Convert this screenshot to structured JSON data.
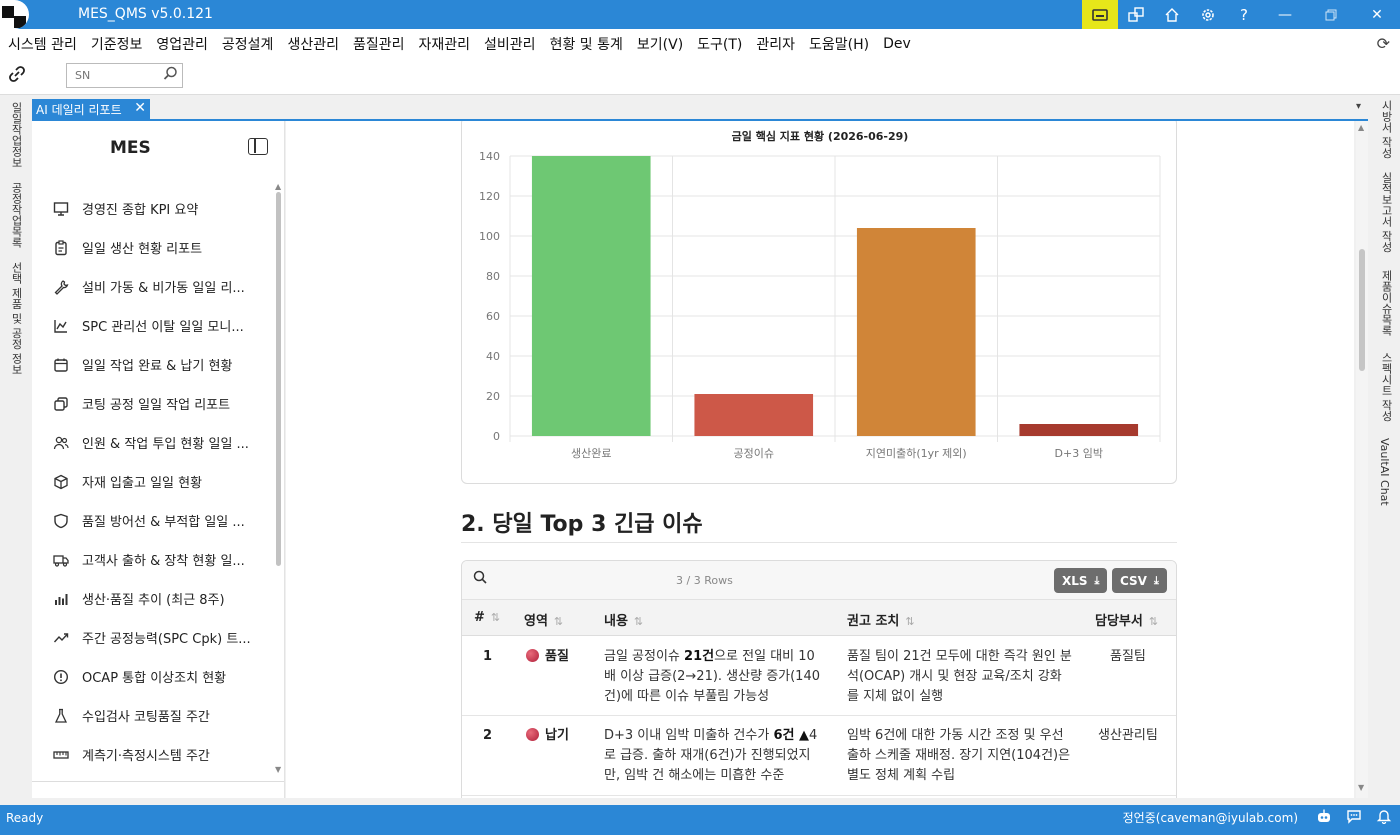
{
  "app": {
    "title": "MES_QMS v5.0.121"
  },
  "menu": [
    "시스템 관리",
    "기준정보",
    "영업관리",
    "공정설계",
    "생산관리",
    "품질관리",
    "자재관리",
    "설비관리",
    "현황 및 통계",
    "보기(V)",
    "도구(T)",
    "관리자",
    "도움말(H)",
    "Dev"
  ],
  "toolbar": {
    "sn_placeholder": "SN"
  },
  "left_tabs": [
    "일일작업정보",
    "공정작업목록",
    "선택 제품 및 공정 정보"
  ],
  "right_tabs": [
    "시방서 작성",
    "실적보고서 작성",
    "제품이슈목록",
    "스펙시트 작성",
    "VaultAI Chat"
  ],
  "doc_tab": {
    "label": "AI 데일리 리포트",
    "close": "✕"
  },
  "sidebar": {
    "title": "MES",
    "items": [
      {
        "label": "경영진 종합 KPI 요약",
        "icon": "presentation-icon"
      },
      {
        "label": "일일 생산 현황 리포트",
        "icon": "clipboard-icon"
      },
      {
        "label": "설비 가동 & 비가동 일일 리...",
        "icon": "wrench-icon"
      },
      {
        "label": "SPC 관리선 이탈 일일 모니...",
        "icon": "spc-chart-icon"
      },
      {
        "label": "일일 작업 완료 & 납기 현황",
        "icon": "calendar-icon"
      },
      {
        "label": "코팅 공정 일일 작업 리포트",
        "icon": "layers-icon"
      },
      {
        "label": "인원 & 작업 투입 현황 일일 ...",
        "icon": "users-icon"
      },
      {
        "label": "자재 입출고 일일 현황",
        "icon": "box-icon"
      },
      {
        "label": "품질 방어선 & 부적합 일일 ...",
        "icon": "shield-icon"
      },
      {
        "label": "고객사 출하 & 장착 현황 일...",
        "icon": "truck-icon"
      },
      {
        "label": "생산·품질 추이 (최근 8주)",
        "icon": "bar-chart-icon"
      },
      {
        "label": "주간 공정능력(SPC Cpk) 트...",
        "icon": "trend-icon"
      },
      {
        "label": "OCAP 통합 이상조치 현황",
        "icon": "alert-icon"
      },
      {
        "label": "수입검사 코팅품질 주간",
        "icon": "flask-icon"
      },
      {
        "label": "계측기·측정시스템 주간",
        "icon": "ruler-icon"
      }
    ]
  },
  "chart_data": {
    "type": "bar",
    "title": "금일 핵심 지표 현황 (2026-06-29)",
    "categories": [
      "생산완료",
      "공정이슈",
      "지연미출하(1yr 제외)",
      "D+3 임박"
    ],
    "values": [
      140,
      21,
      104,
      6
    ],
    "colors": [
      "#6ec873",
      "#cd5848",
      "#d08538",
      "#a63a2e"
    ],
    "ylim": [
      0,
      140
    ],
    "yticks": [
      0,
      20,
      40,
      60,
      80,
      100,
      120,
      140
    ],
    "grid": true
  },
  "section": {
    "title": "2. 당일 Top 3 긴급 이슈"
  },
  "table": {
    "rows_info": "3 / 3 Rows",
    "xls_label": "XLS",
    "csv_label": "CSV",
    "headers": [
      "#",
      "영역",
      "내용",
      "권고 조치",
      "담당부서"
    ],
    "rows": [
      {
        "num": "1",
        "area": "품질",
        "content_pre": "금일 공정이슈 ",
        "content_bold": "21건",
        "content_post": "으로 전일 대비 10배 이상 급증(2→21). 생산량 증가(140건)에 따른 이슈 부풀림 가능성",
        "action": "품질 팀이 21건 모두에 대한 즉각 원인 분석(OCAP) 개시 및 현장 교육/조치 강화를 지체 없이 실행",
        "dept": "품질팀"
      },
      {
        "num": "2",
        "area": "납기",
        "content_pre": "D+3 이내 임박 미출하 건수가 ",
        "content_bold": "6건 ▲",
        "content_post": "4로 급증. 출하 재개(6건)가 진행되었지만, 임박 건 해소에는 미흡한 수준",
        "action": "임박 6건에 대한 가동 시간 조정 및 우선 출하 스케줄 재배정. 장기 지연(104건)은 별도 정체 계획 수립",
        "dept": "생산관리팀"
      }
    ]
  },
  "status": {
    "text": "Ready",
    "user": "정언중(caveman@iyulab.com)"
  }
}
